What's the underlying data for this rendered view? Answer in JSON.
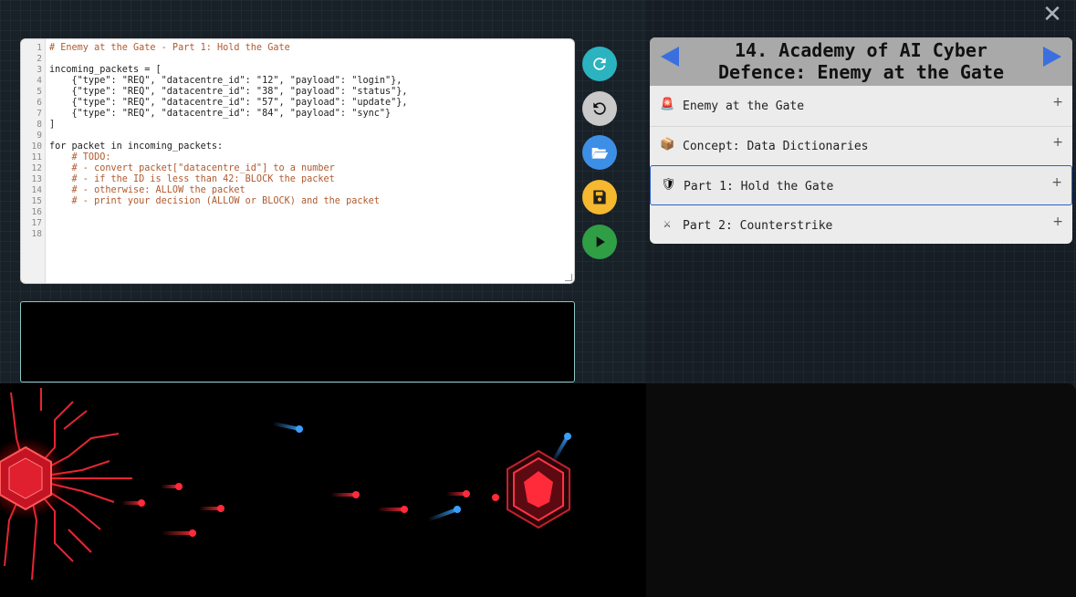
{
  "window": {
    "close_label": "✕"
  },
  "editor": {
    "line_numbers": [
      "1",
      "2",
      "3",
      "4",
      "5",
      "6",
      "7",
      "8",
      "9",
      "10",
      "11",
      "12",
      "13",
      "14",
      "15",
      "16",
      "17",
      "18"
    ],
    "lines": [
      "# Enemy at the Gate - Part 1: Hold the Gate",
      "",
      "incoming_packets = [",
      "    {\"type\": \"REQ\", \"datacentre_id\": \"12\", \"payload\": \"login\"},",
      "    {\"type\": \"REQ\", \"datacentre_id\": \"38\", \"payload\": \"status\"},",
      "    {\"type\": \"REQ\", \"datacentre_id\": \"57\", \"payload\": \"update\"},",
      "    {\"type\": \"REQ\", \"datacentre_id\": \"84\", \"payload\": \"sync\"}",
      "]",
      "",
      "for packet in incoming_packets:",
      "    # TODO:",
      "    # - convert packet[\"datacentre_id\"] to a number",
      "    # - if the ID is less than 42: BLOCK the packet",
      "    # - otherwise: ALLOW the packet",
      "    # - print your decision (ALLOW or BLOCK) and the packet",
      "",
      "",
      ""
    ]
  },
  "console": {
    "output": ""
  },
  "toolbar": {
    "buttons": [
      {
        "name": "refresh-button",
        "icon": "refresh-icon",
        "color": "#2bb3c0"
      },
      {
        "name": "reset-button",
        "icon": "undo-icon",
        "color": "#c9c9c9"
      },
      {
        "name": "open-button",
        "icon": "folder-open-icon",
        "color": "#3d8fe6"
      },
      {
        "name": "save-button",
        "icon": "save-icon",
        "color": "#f5b82e"
      },
      {
        "name": "run-button",
        "icon": "play-icon",
        "color": "#2f9e44"
      }
    ]
  },
  "lesson": {
    "title": "14. Academy of AI Cyber Defence: Enemy at the Gate",
    "items": [
      {
        "icon": "🚨",
        "icon_name": "siren-icon",
        "label": "Enemy at the Gate",
        "active": false
      },
      {
        "icon": "📦",
        "icon_name": "package-icon",
        "label": "Concept: Data Dictionaries",
        "active": false
      },
      {
        "icon": "🛡",
        "icon_name": "shield-icon",
        "label": "Part 1: Hold the Gate",
        "active": true
      },
      {
        "icon": "⚔",
        "icon_name": "crossed-swords-icon",
        "label": "Part 2: Counterstrike",
        "active": false
      }
    ],
    "expand_label": "+"
  },
  "colors": {
    "accent": "#3b6fe0",
    "packet_red": "#ff2a3a",
    "packet_blue": "#3aa0ff"
  }
}
